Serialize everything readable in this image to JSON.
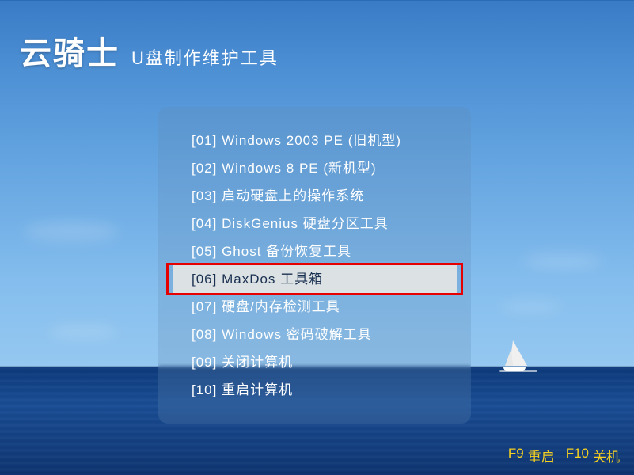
{
  "brand": {
    "logo": "云骑士",
    "subtitle": "U盘制作维护工具"
  },
  "menu": {
    "items": [
      {
        "label": "[01] Windows 2003 PE (旧机型)"
      },
      {
        "label": "[02] Windows 8 PE (新机型)"
      },
      {
        "label": "[03] 启动硬盘上的操作系统"
      },
      {
        "label": "[04] DiskGenius 硬盘分区工具"
      },
      {
        "label": "[05] Ghost 备份恢复工具"
      },
      {
        "label": "[06] MaxDos 工具箱"
      },
      {
        "label": "[07] 硬盘/内存检测工具"
      },
      {
        "label": "[08] Windows 密码破解工具"
      },
      {
        "label": "[09] 关闭计算机"
      },
      {
        "label": "[10] 重启计算机"
      }
    ],
    "selected_index": 5
  },
  "footer": {
    "hints": [
      {
        "key": "F9",
        "label": "重启"
      },
      {
        "key": "F10",
        "label": "关机"
      }
    ]
  }
}
